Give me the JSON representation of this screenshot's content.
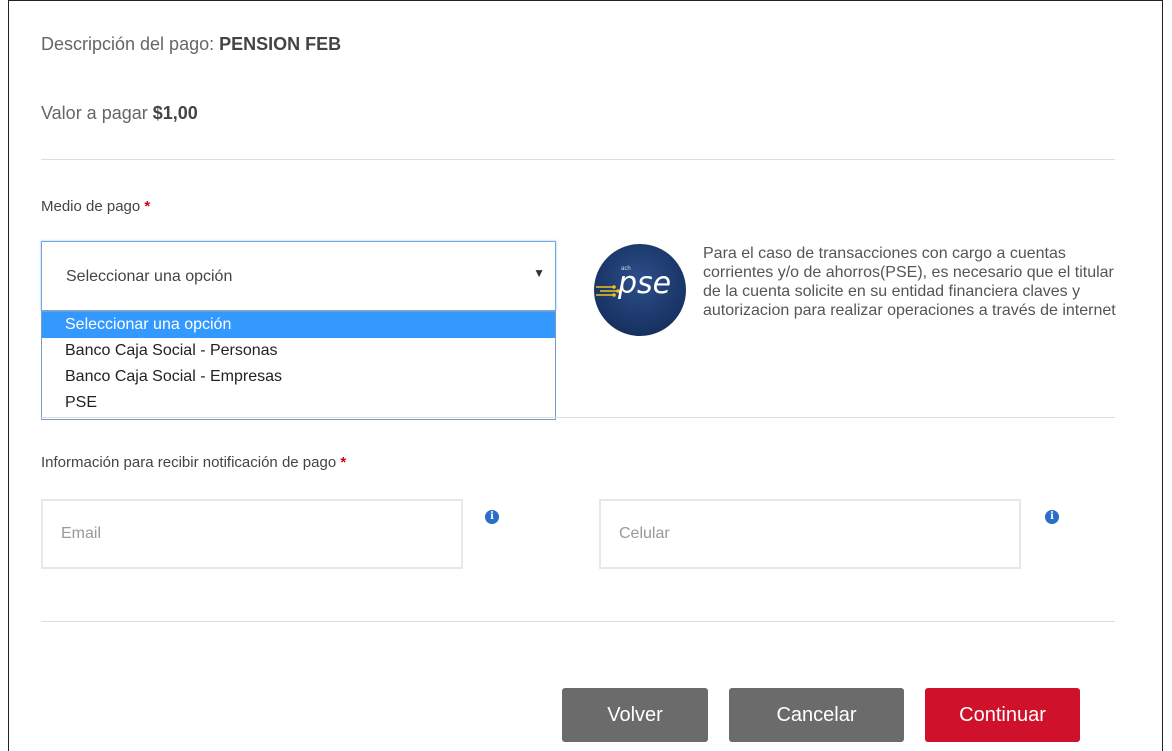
{
  "payment": {
    "description_label": "Descripción del pago:",
    "description_value": "PENSION FEB",
    "amount_label": "Valor a pagar",
    "amount_value": "$1,00"
  },
  "payment_method": {
    "label": "Medio de pago",
    "required_mark": "*",
    "selected_value": "Seleccionar una opción",
    "options": [
      "Seleccionar una opción",
      "Banco Caja Social - Personas",
      "Banco Caja Social - Empresas",
      "PSE"
    ],
    "arrow_glyph": "▼"
  },
  "pse": {
    "logo_text": "pse",
    "logo_small_text": "ach",
    "info_text": "Para el caso de transacciones con cargo a cuentas corrientes y/o de ahorros(PSE), es necesario que el titular de la cuenta solicite en su entidad financiera claves y autorizacion para realizar operaciones a través de internet"
  },
  "notification": {
    "label": "Información para recibir notificación de pago",
    "required_mark": "*",
    "email_placeholder": "Email",
    "phone_placeholder": "Celular",
    "info_glyph": "i"
  },
  "buttons": {
    "back": "Volver",
    "cancel": "Cancelar",
    "continue": "Continuar"
  },
  "colors": {
    "selected_option": "#3399ff",
    "primary_button": "#d0112b",
    "secondary_button": "#6b6b6b",
    "required_mark": "#d0021b",
    "info_icon": "#2a6fc4"
  }
}
